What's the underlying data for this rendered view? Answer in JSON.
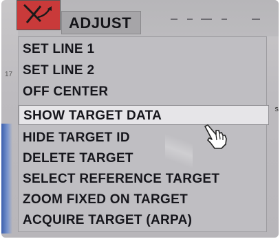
{
  "header": {
    "menu_button_label": "ADJUST",
    "icon": "radar-adjust-icon",
    "status_dashes": "- --- -"
  },
  "edge_labels": {
    "left": "17",
    "right": "s"
  },
  "menu": {
    "items": [
      {
        "label": "SET LINE 1"
      },
      {
        "label": "SET LINE 2"
      },
      {
        "label": "OFF CENTER"
      },
      {
        "label": "SHOW TARGET DATA",
        "highlighted": true
      },
      {
        "label": "HIDE TARGET ID"
      },
      {
        "label": "DELETE TARGET"
      },
      {
        "label": "SELECT REFERENCE TARGET"
      },
      {
        "label": "ZOOM FIXED ON TARGET"
      },
      {
        "label": "ACQUIRE TARGET (ARPA)"
      }
    ]
  },
  "colors": {
    "icon_tile": "#c93a3a",
    "menu_bg": "#bfbec2",
    "highlight_bg": "#e6e5e8",
    "text": "#16161c"
  },
  "cursor": "pointing-hand-cursor-icon"
}
